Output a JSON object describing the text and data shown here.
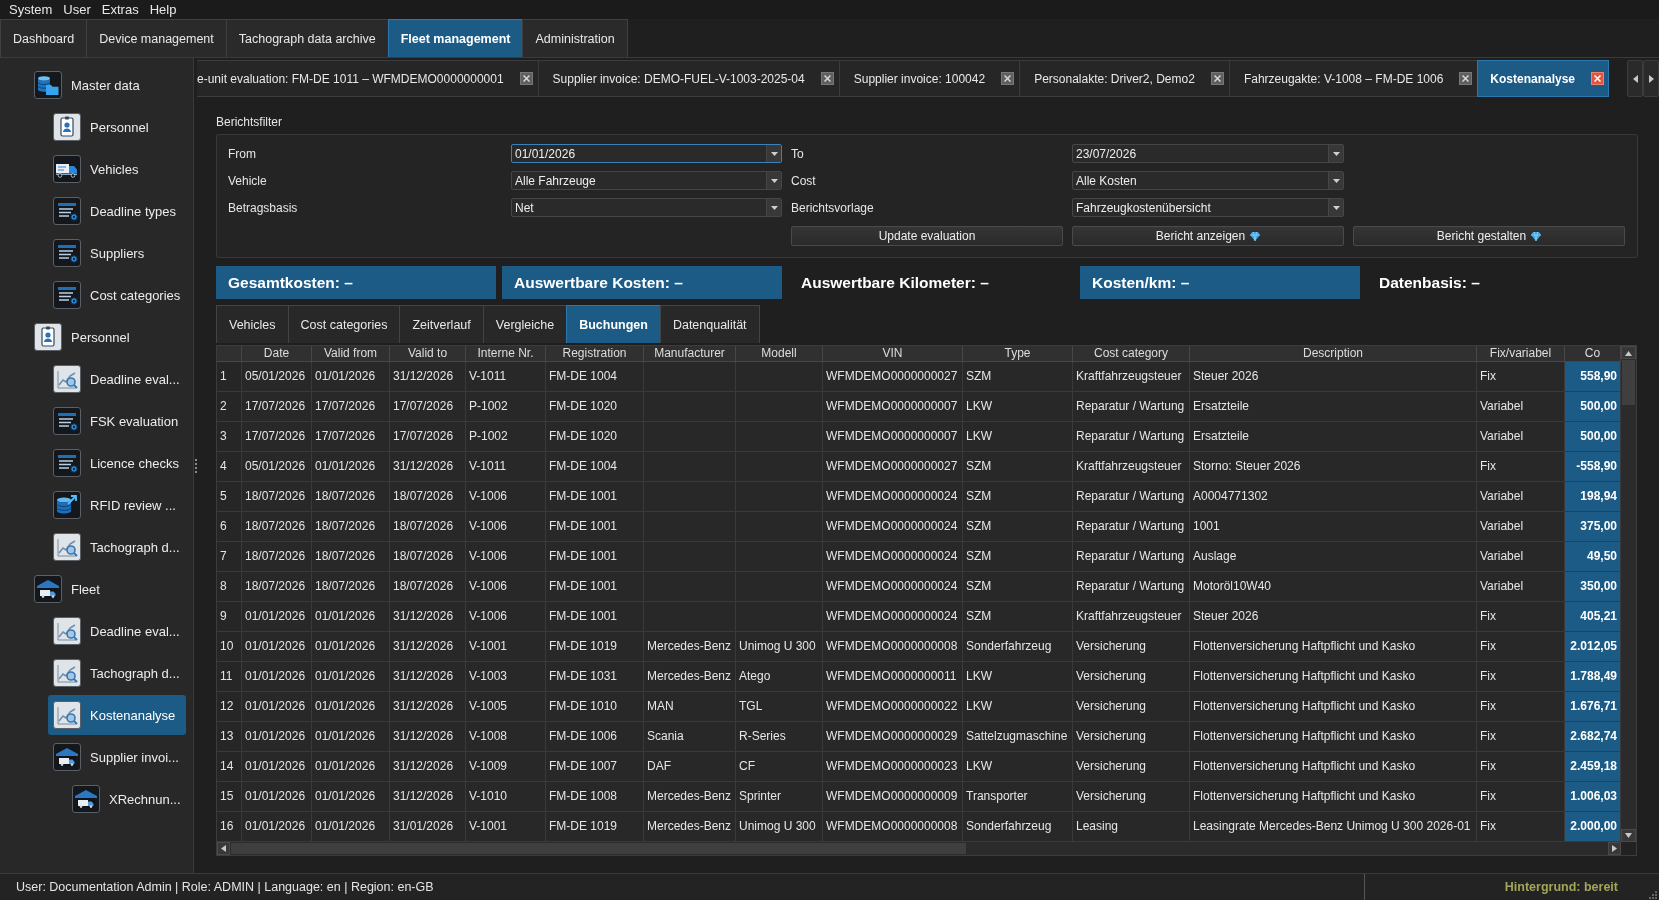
{
  "menu": [
    "System",
    "User",
    "Extras",
    "Help"
  ],
  "main_tabs": [
    {
      "label": "Dashboard",
      "selected": false
    },
    {
      "label": "Device management",
      "selected": false
    },
    {
      "label": "Tachograph data archive",
      "selected": false
    },
    {
      "label": "Fleet management",
      "selected": true
    },
    {
      "label": "Administration",
      "selected": false
    }
  ],
  "sidebar": {
    "items": [
      {
        "label": "Master data",
        "kind": "data",
        "selected": false,
        "children": [
          {
            "label": "Personnel",
            "kind": "person",
            "selected": false
          },
          {
            "label": "Vehicles",
            "kind": "vehicle",
            "selected": false
          },
          {
            "label": "Deadline types",
            "kind": "register",
            "selected": false
          },
          {
            "label": "Suppliers",
            "kind": "register",
            "selected": false
          },
          {
            "label": "Cost categories",
            "kind": "register",
            "selected": false
          }
        ]
      },
      {
        "label": "Personnel",
        "kind": "person",
        "selected": false,
        "children": [
          {
            "label": "Deadline eval...",
            "kind": "report",
            "selected": false
          },
          {
            "label": "FSK evaluation",
            "kind": "register",
            "selected": false
          },
          {
            "label": "Licence checks",
            "kind": "register",
            "selected": false
          },
          {
            "label": "RFID review ...",
            "kind": "import",
            "selected": false
          },
          {
            "label": "Tachograph d...",
            "kind": "report",
            "selected": false
          }
        ]
      },
      {
        "label": "Fleet",
        "kind": "fleet",
        "selected": false,
        "children": [
          {
            "label": "Deadline eval...",
            "kind": "report",
            "selected": false
          },
          {
            "label": "Tachograph d...",
            "kind": "report",
            "selected": false
          },
          {
            "label": "Kostenanalyse",
            "kind": "report",
            "selected": true
          },
          {
            "label": "Supplier invoi...",
            "kind": "fleet",
            "selected": false,
            "children": [
              {
                "label": "XRechnun...",
                "kind": "fleet",
                "selected": false
              }
            ]
          }
        ]
      }
    ]
  },
  "document_tabs": [
    {
      "label": "e-unit evaluation: FM-DE 1011 – WFMDEMO0000000001",
      "selected": false
    },
    {
      "label": "Supplier invoice: DEMO-FUEL-V-1003-2025-04",
      "selected": false
    },
    {
      "label": "Supplier invoice: 100042",
      "selected": false
    },
    {
      "label": "Personalakte: Driver2, Demo2",
      "selected": false
    },
    {
      "label": "Fahrzeugakte: V-1008 – FM-DE 1006",
      "selected": false
    },
    {
      "label": "Kostenanalyse",
      "selected": true
    }
  ],
  "filter": {
    "title": "Berichtsfilter",
    "fields": [
      {
        "label": "From",
        "value": "01/01/2026",
        "focused": true
      },
      {
        "label": "To",
        "value": "23/07/2026",
        "focused": false
      },
      {
        "label": "Vehicle",
        "value": "Alle Fahrzeuge",
        "focused": false
      },
      {
        "label": "Cost",
        "value": "Alle Kosten",
        "focused": false
      },
      {
        "label": "Betragsbasis",
        "value": "Net",
        "focused": false
      },
      {
        "label": "Berichtsvorlage",
        "value": "Fahrzeugkostenübersicht",
        "focused": false
      }
    ],
    "buttons": [
      {
        "label": "Update evaluation",
        "premium": false
      },
      {
        "label": "Bericht anzeigen",
        "premium": true
      },
      {
        "label": "Bericht gestalten",
        "premium": true
      }
    ]
  },
  "kpis": [
    {
      "label": "Gesamtkosten: –",
      "highlighted": true
    },
    {
      "label": "Auswertbare Kosten: –",
      "highlighted": true
    },
    {
      "label": "Auswertbare Kilometer: –",
      "highlighted": false
    },
    {
      "label": "Kosten/km: –",
      "highlighted": true
    },
    {
      "label": "Datenbasis: –",
      "highlighted": false
    }
  ],
  "view_tabs": [
    {
      "label": "Vehicles",
      "selected": false
    },
    {
      "label": "Cost categories",
      "selected": false
    },
    {
      "label": "Zeitverlauf",
      "selected": false
    },
    {
      "label": "Vergleiche",
      "selected": false
    },
    {
      "label": "Buchungen",
      "selected": true
    },
    {
      "label": "Datenqualität",
      "selected": false
    }
  ],
  "table": {
    "columns": [
      "Date",
      "Valid from",
      "Valid to",
      "Interne Nr.",
      "Registration",
      "Manufacturer",
      "Modell",
      "VIN",
      "Type",
      "Cost category",
      "Description",
      "Fix/variabel",
      "Co"
    ],
    "rows": [
      {
        "n": "1",
        "date": "05/01/2026",
        "valid_from": "01/01/2026",
        "valid_to": "31/12/2026",
        "internal_no": "V-1011",
        "registration": "FM-DE 1004",
        "vin": "WFMDEMO0000000027",
        "type": "SZM",
        "cost_category": "Kraftfahrzeugsteuer",
        "description": "Steuer 2026",
        "fix_variable": "Fix",
        "column_13": "558,90"
      },
      {
        "n": "2",
        "date": "17/07/2026",
        "valid_from": "17/07/2026",
        "valid_to": "17/07/2026",
        "internal_no": "P-1002",
        "registration": "FM-DE 1020",
        "vin": "WFMDEMO0000000007",
        "type": "LKW",
        "cost_category": "Reparatur / Wartung",
        "description": "Ersatzteile",
        "fix_variable": "Variabel",
        "column_13": "500,00"
      },
      {
        "n": "3",
        "date": "17/07/2026",
        "valid_from": "17/07/2026",
        "valid_to": "17/07/2026",
        "internal_no": "P-1002",
        "registration": "FM-DE 1020",
        "vin": "WFMDEMO0000000007",
        "type": "LKW",
        "cost_category": "Reparatur / Wartung",
        "description": "Ersatzteile",
        "fix_variable": "Variabel",
        "column_13": "500,00"
      },
      {
        "n": "4",
        "date": "05/01/2026",
        "valid_from": "01/01/2026",
        "valid_to": "31/12/2026",
        "internal_no": "V-1011",
        "registration": "FM-DE 1004",
        "vin": "WFMDEMO0000000027",
        "type": "SZM",
        "cost_category": "Kraftfahrzeugsteuer",
        "description": "Storno: Steuer 2026",
        "fix_variable": "Fix",
        "column_13": "-558,90"
      },
      {
        "n": "5",
        "date": "18/07/2026",
        "valid_from": "18/07/2026",
        "valid_to": "18/07/2026",
        "internal_no": "V-1006",
        "registration": "FM-DE 1001",
        "vin": "WFMDEMO0000000024",
        "type": "SZM",
        "cost_category": "Reparatur / Wartung",
        "description": "A0004771302",
        "fix_variable": "Variabel",
        "column_13": "198,94"
      },
      {
        "n": "6",
        "date": "18/07/2026",
        "valid_from": "18/07/2026",
        "valid_to": "18/07/2026",
        "internal_no": "V-1006",
        "registration": "FM-DE 1001",
        "vin": "WFMDEMO0000000024",
        "type": "SZM",
        "cost_category": "Reparatur / Wartung",
        "description": "1001",
        "fix_variable": "Variabel",
        "column_13": "375,00"
      },
      {
        "n": "7",
        "date": "18/07/2026",
        "valid_from": "18/07/2026",
        "valid_to": "18/07/2026",
        "internal_no": "V-1006",
        "registration": "FM-DE 1001",
        "vin": "WFMDEMO0000000024",
        "type": "SZM",
        "cost_category": "Reparatur / Wartung",
        "description": "Auslage",
        "fix_variable": "Variabel",
        "column_13": "49,50"
      },
      {
        "n": "8",
        "date": "18/07/2026",
        "valid_from": "18/07/2026",
        "valid_to": "18/07/2026",
        "internal_no": "V-1006",
        "registration": "FM-DE 1001",
        "vin": "WFMDEMO0000000024",
        "type": "SZM",
        "cost_category": "Reparatur / Wartung",
        "description": "Motoröl10W40",
        "fix_variable": "Variabel",
        "column_13": "350,00"
      },
      {
        "n": "9",
        "date": "01/01/2026",
        "valid_from": "01/01/2026",
        "valid_to": "31/12/2026",
        "internal_no": "V-1006",
        "registration": "FM-DE 1001",
        "vin": "WFMDEMO0000000024",
        "type": "SZM",
        "cost_category": "Kraftfahrzeugsteuer",
        "description": "Steuer 2026",
        "fix_variable": "Fix",
        "column_13": "405,21"
      },
      {
        "n": "10",
        "date": "01/01/2026",
        "valid_from": "01/01/2026",
        "valid_to": "31/12/2026",
        "internal_no": "V-1001",
        "registration": "FM-DE 1019",
        "manufacturer": "Mercedes-Benz",
        "model": "Unimog U 300",
        "vin": "WFMDEMO0000000008",
        "type": "Sonderfahrzeug",
        "cost_category": "Versicherung",
        "description": "Flottenversicherung Haftpflicht und Kasko",
        "fix_variable": "Fix",
        "column_13": "2.012,05"
      },
      {
        "n": "11",
        "date": "01/01/2026",
        "valid_from": "01/01/2026",
        "valid_to": "31/12/2026",
        "internal_no": "V-1003",
        "registration": "FM-DE 1031",
        "manufacturer": "Mercedes-Benz",
        "model": "Atego",
        "vin": "WFMDEMO0000000011",
        "type": "LKW",
        "cost_category": "Versicherung",
        "description": "Flottenversicherung Haftpflicht und Kasko",
        "fix_variable": "Fix",
        "column_13": "1.788,49"
      },
      {
        "n": "12",
        "date": "01/01/2026",
        "valid_from": "01/01/2026",
        "valid_to": "31/12/2026",
        "internal_no": "V-1005",
        "registration": "FM-DE 1010",
        "manufacturer": "MAN",
        "model": "TGL",
        "vin": "WFMDEMO0000000022",
        "type": "LKW",
        "cost_category": "Versicherung",
        "description": "Flottenversicherung Haftpflicht und Kasko",
        "fix_variable": "Fix",
        "column_13": "1.676,71"
      },
      {
        "n": "13",
        "date": "01/01/2026",
        "valid_from": "01/01/2026",
        "valid_to": "31/12/2026",
        "internal_no": "V-1008",
        "registration": "FM-DE 1006",
        "manufacturer": "Scania",
        "model": "R-Series",
        "vin": "WFMDEMO0000000029",
        "type": "Sattelzugmaschine",
        "cost_category": "Versicherung",
        "description": "Flottenversicherung Haftpflicht und Kasko",
        "fix_variable": "Fix",
        "column_13": "2.682,74"
      },
      {
        "n": "14",
        "date": "01/01/2026",
        "valid_from": "01/01/2026",
        "valid_to": "31/12/2026",
        "internal_no": "V-1009",
        "registration": "FM-DE 1007",
        "manufacturer": "DAF",
        "model": "CF",
        "vin": "WFMDEMO0000000023",
        "type": "LKW",
        "cost_category": "Versicherung",
        "description": "Flottenversicherung Haftpflicht und Kasko",
        "fix_variable": "Fix",
        "column_13": "2.459,18"
      },
      {
        "n": "15",
        "date": "01/01/2026",
        "valid_from": "01/01/2026",
        "valid_to": "31/12/2026",
        "internal_no": "V-1010",
        "registration": "FM-DE 1008",
        "manufacturer": "Mercedes-Benz",
        "model": "Sprinter",
        "vin": "WFMDEMO0000000009",
        "type": "Transporter",
        "cost_category": "Versicherung",
        "description": "Flottenversicherung Haftpflicht und Kasko",
        "fix_variable": "Fix",
        "column_13": "1.006,03"
      },
      {
        "n": "16",
        "date": "01/01/2026",
        "valid_from": "01/01/2026",
        "valid_to": "31/01/2026",
        "internal_no": "V-1001",
        "registration": "FM-DE 1019",
        "manufacturer": "Mercedes-Benz",
        "model": "Unimog U 300",
        "vin": "WFMDEMO0000000008",
        "type": "Sonderfahrzeug",
        "cost_category": "Leasing",
        "description": "Leasingrate Mercedes-Benz Unimog U 300 2026-01",
        "fix_variable": "Fix",
        "column_13": "2.000,00"
      }
    ]
  },
  "status_bar": {
    "session": "User: Documentation Admin | Role: ADMIN | Language: en | Region: en-GB",
    "background_task": "Hintergrund: bereit"
  }
}
